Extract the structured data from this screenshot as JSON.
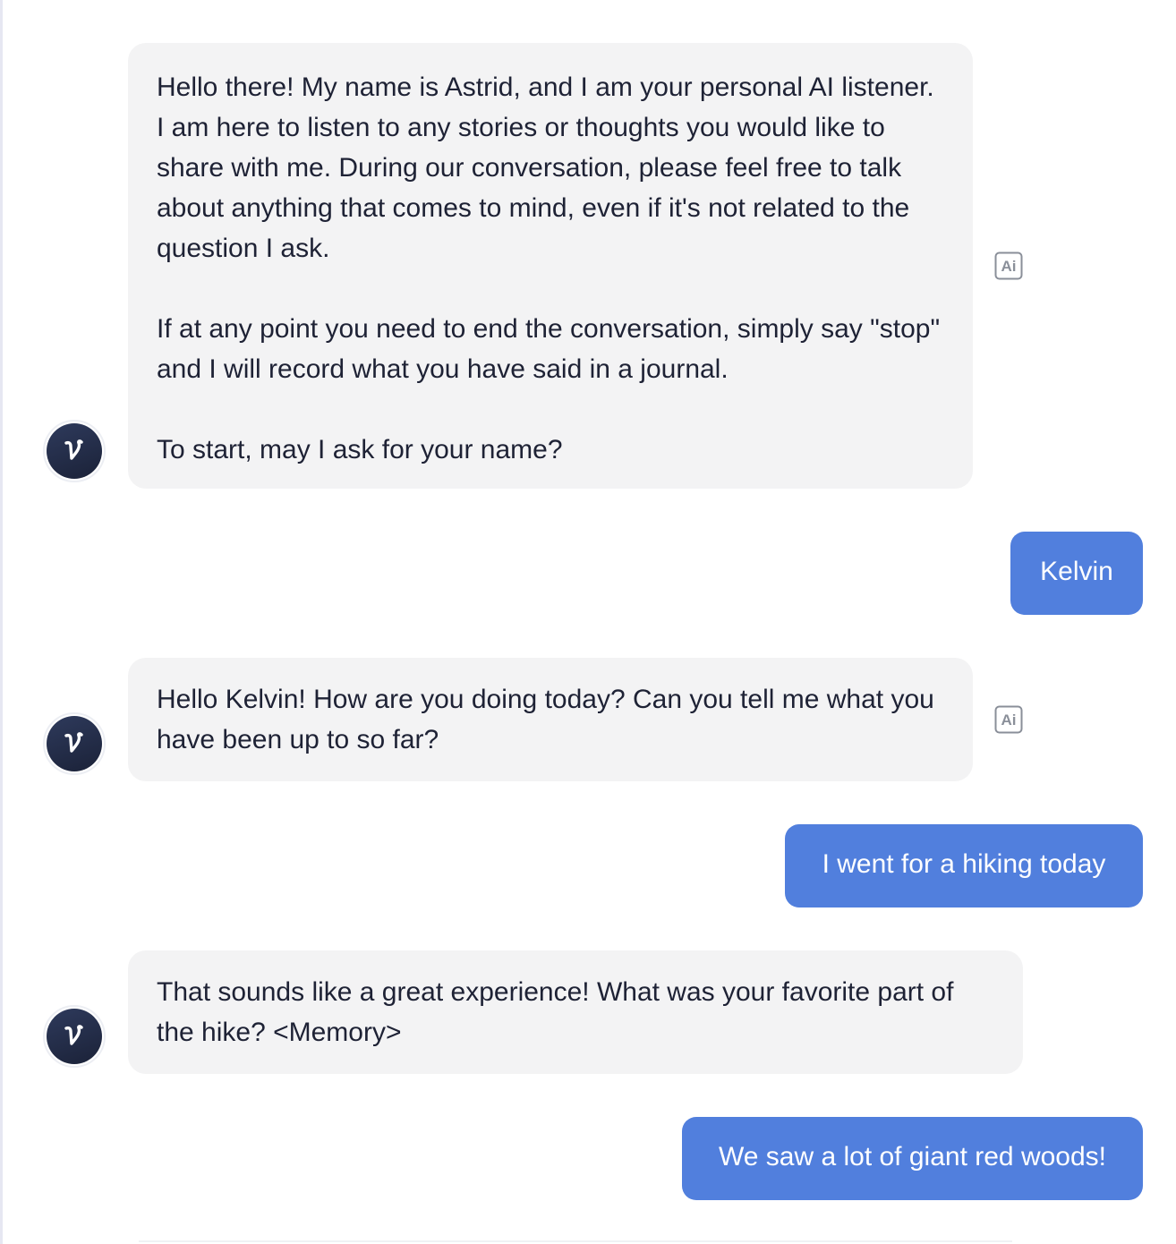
{
  "colors": {
    "bot_bubble": "#f3f3f4",
    "user_bubble": "#517fdd",
    "text_dark": "#1e2235",
    "avatar_bg": "#1f2742"
  },
  "avatar": {
    "glyph": "v",
    "icon": "v-logo-icon"
  },
  "ai_badge": {
    "icon": "ai-badge-icon",
    "label": "Ai"
  },
  "messages": [
    {
      "role": "assistant",
      "text": "Hello there! My name is Astrid, and I am your personal AI listener. I am here to listen to any stories or thoughts you would like to share with me. During our conversation, please feel free to talk about anything that comes to mind, even if it's not related to the question I ask.\n\nIf at any point you need to end the conversation, simply say \"stop\" and I will record what you have said in a journal.\n\nTo start, may I ask for your name?"
    },
    {
      "role": "user",
      "text": "Kelvin"
    },
    {
      "role": "assistant",
      "text": "Hello Kelvin! How are you doing today? Can you tell me what you have been up to so far?"
    },
    {
      "role": "user",
      "text": "I went for a hiking today"
    },
    {
      "role": "assistant",
      "text": "That sounds like a great experience! What was your favorite part of the hike? <Memory>"
    },
    {
      "role": "user",
      "text": "We saw a lot of giant red woods!"
    }
  ]
}
